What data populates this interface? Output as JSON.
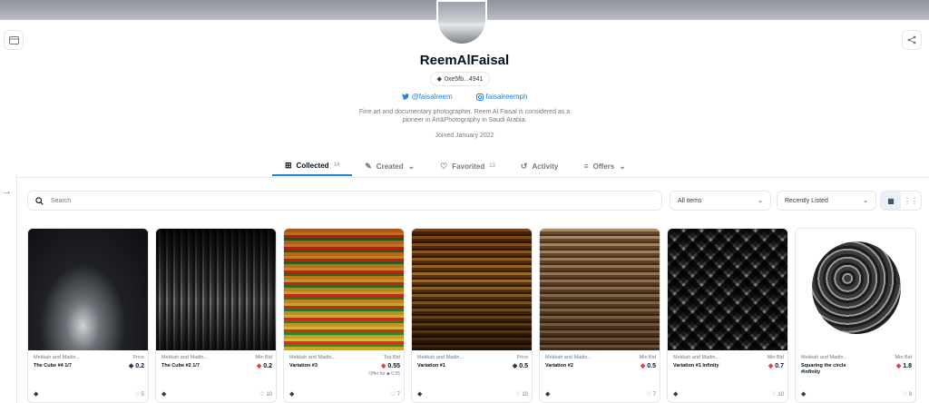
{
  "profile": {
    "name": "ReemAlFaisal",
    "wallet": "0xe5fb...4941",
    "twitter": "@faisalreem",
    "instagram": "faisalreemph",
    "bio": "Fine art and documentary photographer. Reem Al Faisal is considered as a pioneer in Art&Photography in Saudi Arabia.",
    "joined": "Joined January 2022"
  },
  "tabs": [
    {
      "label": "Collected",
      "count": "14",
      "icon": "image-plus-icon",
      "active": true
    },
    {
      "label": "Created",
      "count": "",
      "icon": "brush-icon",
      "dropdown": true
    },
    {
      "label": "Favorited",
      "count": "13",
      "icon": "heart-icon"
    },
    {
      "label": "Activity",
      "count": "",
      "icon": "history-icon"
    },
    {
      "label": "Offers",
      "count": "",
      "icon": "list-icon",
      "dropdown": true
    }
  ],
  "filters": {
    "search_placeholder": "Search",
    "items_select": "All items",
    "sort_select": "Recently Listed"
  },
  "items": [
    {
      "collection": "Mekkah and Madin...",
      "title": "The Cube #4 1/7",
      "title2": "",
      "price_label": "Price",
      "price": "0.2",
      "eth_color": "dark",
      "offer": "",
      "likes": "5"
    },
    {
      "collection": "Mekkah and Madin...",
      "title": "The Cube #2 1/7",
      "title2": "",
      "price_label": "Min Bid",
      "price": "0.2",
      "eth_color": "red",
      "offer": "",
      "likes": "10"
    },
    {
      "collection": "Mekkah and Madin...",
      "title": "Variation #3",
      "title2": "",
      "price_label": "Top Bid",
      "price": "0.55",
      "eth_color": "red",
      "offer": "Offer for ◆ 0.55",
      "likes": "7"
    },
    {
      "collection": "Mekkah and Madin...",
      "title": "Variation #1",
      "title2": "",
      "price_label": "Price",
      "price": "0.5",
      "eth_color": "dark",
      "offer": "",
      "likes": "10"
    },
    {
      "collection": "Mekkah and Madin...",
      "title": "Variation #2",
      "title2": "",
      "price_label": "Min Bid",
      "price": "0.5",
      "eth_color": "red",
      "offer": "",
      "likes": "7"
    },
    {
      "collection": "Mekkah and Madin...",
      "title": "Variation #1 Infinity",
      "title2": "",
      "price_label": "Min Bid",
      "price": "0.7",
      "eth_color": "red",
      "offer": "",
      "likes": "10"
    },
    {
      "collection": "Mekkah and Madin...",
      "title": "Squaring the circle",
      "title2": "#infinity",
      "price_label": "Min Bid",
      "price": "1.8",
      "eth_color": "red",
      "offer": "",
      "likes": "9"
    }
  ],
  "colors": {
    "accent": "#2081e2",
    "text": "#04111d",
    "muted": "#707a83",
    "border": "#e5e8eb",
    "bid_eth": "#e2404f"
  }
}
